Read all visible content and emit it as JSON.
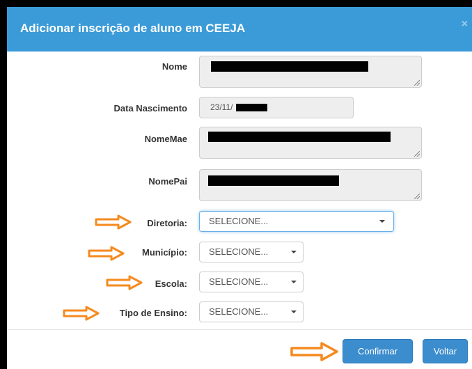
{
  "modal": {
    "title": "Adicionar inscrição de aluno em CEEJA",
    "close_label": "×"
  },
  "fields": {
    "nome_label": "Nome",
    "data_nascimento_label": "Data Nascimento",
    "data_nascimento_value": "23/11/",
    "nome_mae_label": "NomeMae",
    "nome_pai_label": "NomePai",
    "diretoria_label": "Diretoria:",
    "diretoria_value": "SELECIONE...",
    "municipio_label": "Município:",
    "municipio_value": "SELECIONE...",
    "escola_label": "Escola:",
    "escola_value": "SELECIONE...",
    "tipo_ensino_label": "Tipo de Ensino:",
    "tipo_ensino_value": "SELECIONE..."
  },
  "footer": {
    "confirm_label": "Confirmar",
    "back_label": "Voltar"
  },
  "colors": {
    "header": "#3b9bd8",
    "button": "#3c8dcd",
    "annotation_arrow": "#f58a1f"
  },
  "icons": [
    "close-icon",
    "dropdown-caret-icon",
    "resize-grip-icon",
    "annotation-arrow-icon"
  ]
}
